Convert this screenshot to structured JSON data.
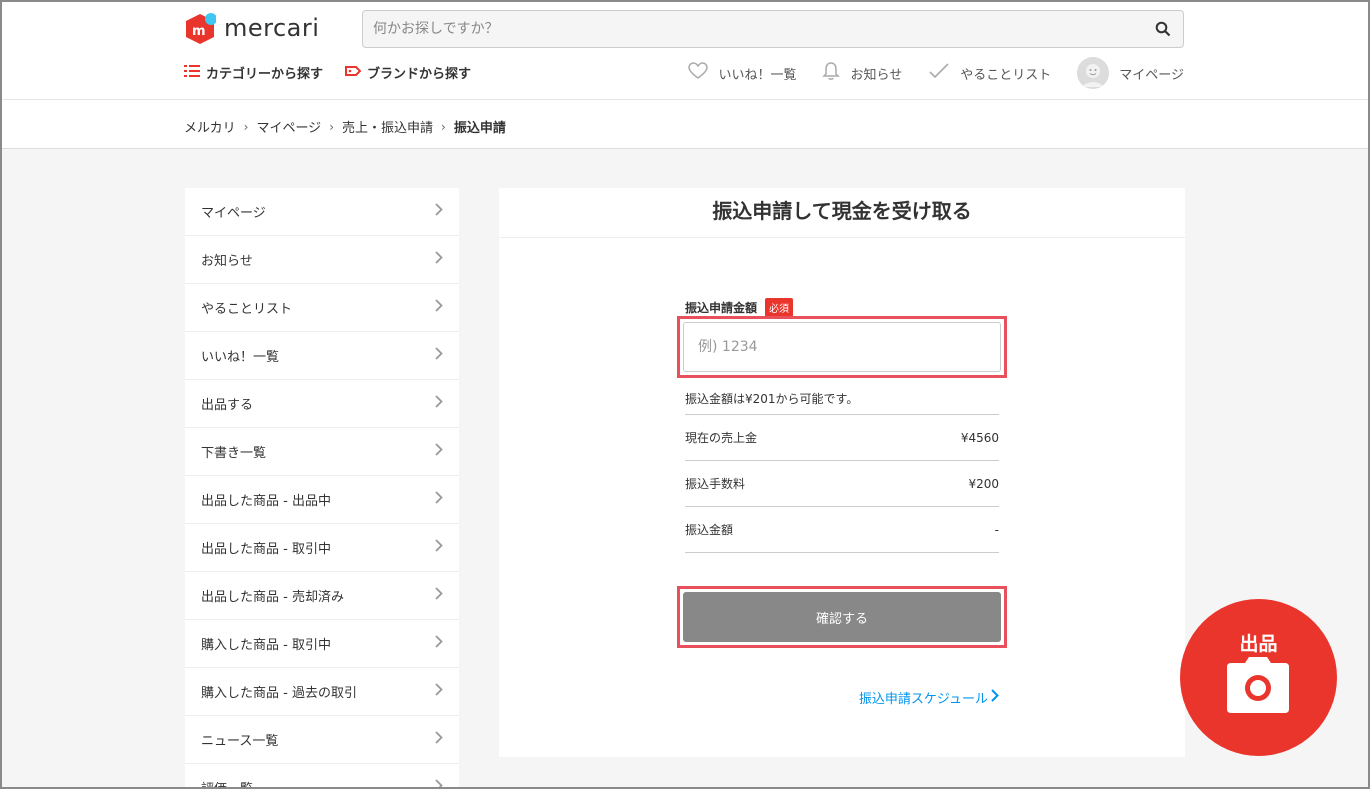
{
  "header": {
    "logo_text": "mercari",
    "search_placeholder": "何かお探しですか？",
    "nav_left": [
      "カテゴリーから探す",
      "ブランドから探す"
    ],
    "nav_right": [
      "いいね！一覧",
      "お知らせ",
      "やることリスト",
      "マイページ"
    ]
  },
  "breadcrumb": {
    "items": [
      "メルカリ",
      "マイページ",
      "売上・振込申請"
    ],
    "current": "振込申請"
  },
  "sidebar": {
    "items": [
      "マイページ",
      "お知らせ",
      "やることリスト",
      "いいね！一覧",
      "出品する",
      "下書き一覧",
      "出品した商品 - 出品中",
      "出品した商品 - 取引中",
      "出品した商品 - 売却済み",
      "購入した商品 - 取引中",
      "購入した商品 - 過去の取引",
      "ニュース一覧",
      "評価一覧"
    ]
  },
  "panel": {
    "title": "振込申請して現金を受け取る",
    "amount_label": "振込申請金額",
    "required_badge": "必須",
    "amount_placeholder": "例) 1234",
    "hint": "振込金額は¥201から可能です。",
    "rows": [
      {
        "label": "現在の売上金",
        "value": "¥4560"
      },
      {
        "label": "振込手数料",
        "value": "¥200"
      },
      {
        "label": "振込金額",
        "value": "-"
      }
    ],
    "confirm_label": "確認する",
    "schedule_link": "振込申請スケジュール"
  },
  "fab": {
    "label": "出品"
  },
  "colors": {
    "brand_red": "#ea352d",
    "highlight_border": "#e8505b",
    "link_blue": "#0095ee",
    "button_gray": "#888888",
    "page_bg": "#f5f5f5"
  }
}
